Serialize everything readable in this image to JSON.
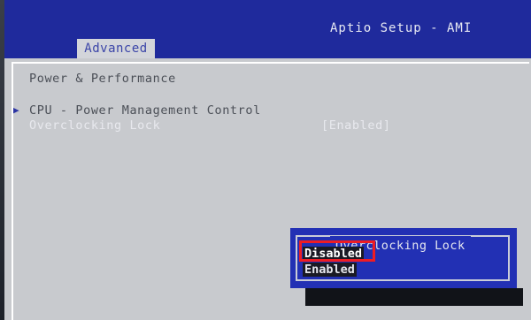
{
  "app": {
    "title": "Aptio Setup - AMI"
  },
  "tabs": [
    {
      "label": "Advanced"
    }
  ],
  "main": {
    "section_title": "Power & Performance",
    "items": [
      {
        "arrow": "▶",
        "label": "CPU - Power Management Control"
      },
      {
        "label": "Overclocking Lock",
        "value": "[Enabled]"
      }
    ]
  },
  "popup": {
    "title": "Overclocking Lock",
    "options": [
      {
        "label": "Disabled",
        "selected": true
      },
      {
        "label": "Enabled",
        "selected": false
      }
    ]
  },
  "colors": {
    "header_bg": "#1f2a9c",
    "content_bg": "#c8cace",
    "popup_bg": "#2230b4",
    "highlight": "#ee1c24"
  }
}
